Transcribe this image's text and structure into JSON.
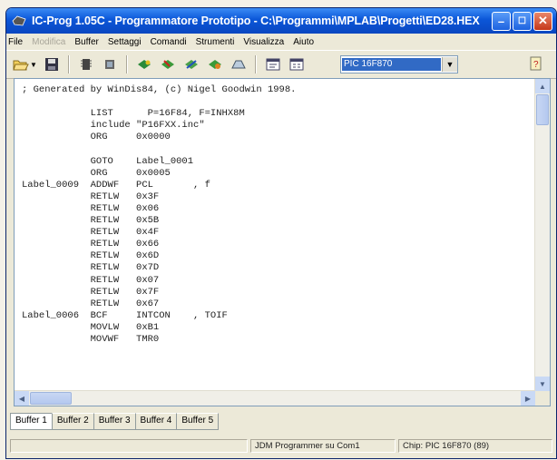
{
  "window": {
    "title": "IC-Prog 1.05C - Programmatore Prototipo - C:\\Programmi\\MPLAB\\Progetti\\ED28.HEX"
  },
  "menu": [
    "File",
    "Modifica",
    "Buffer",
    "Settaggi",
    "Comandi",
    "Strumenti",
    "Visualizza",
    "Aiuto"
  ],
  "toolbar": {
    "device": "PIC 16F870"
  },
  "code_lines": [
    "; Generated by WinDis84, (c) Nigel Goodwin 1998.",
    "",
    "            LIST      P=16F84, F=INHX8M",
    "            include \"P16FXX.inc\"",
    "            ORG     0x0000",
    "",
    "            GOTO    Label_0001",
    "            ORG     0x0005",
    "Label_0009  ADDWF   PCL       , f",
    "            RETLW   0x3F",
    "            RETLW   0x06",
    "            RETLW   0x5B",
    "            RETLW   0x4F",
    "            RETLW   0x66",
    "            RETLW   0x6D",
    "            RETLW   0x7D",
    "            RETLW   0x07",
    "            RETLW   0x7F",
    "            RETLW   0x67",
    "Label_0006  BCF     INTCON    , TOIF",
    "            MOVLW   0xB1",
    "            MOVWF   TMR0"
  ],
  "tabs": [
    "Buffer 1",
    "Buffer 2",
    "Buffer 3",
    "Buffer 4",
    "Buffer 5"
  ],
  "status": {
    "programmer": "JDM Programmer su Com1",
    "chip": "Chip: PIC 16F870  (89)"
  }
}
